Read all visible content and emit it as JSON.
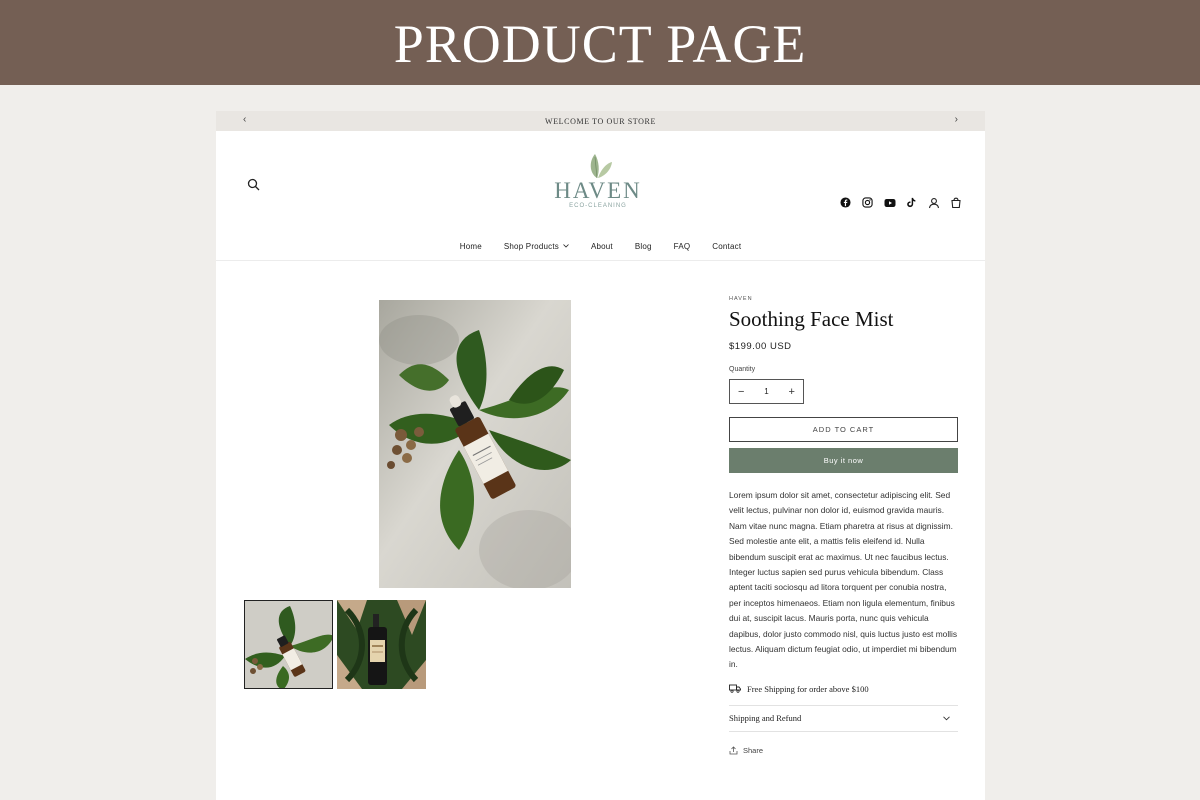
{
  "banner": {
    "title": "PRODUCT PAGE"
  },
  "announcement": {
    "text": "WELCOME TO OUR STORE",
    "prev_icon": "chevron-left-icon",
    "next_icon": "chevron-right-icon"
  },
  "logo": {
    "name": "HAVEN",
    "tagline": "ECO-CLEANING"
  },
  "header_icons": [
    "facebook-icon",
    "instagram-icon",
    "youtube-icon",
    "tiktok-icon",
    "account-icon",
    "cart-icon"
  ],
  "nav": {
    "items": [
      {
        "label": "Home"
      },
      {
        "label": "Shop Products"
      },
      {
        "label": "About"
      },
      {
        "label": "Blog"
      },
      {
        "label": "FAQ"
      },
      {
        "label": "Contact"
      }
    ]
  },
  "product": {
    "vendor": "HAVEN",
    "title": "Soothing Face Mist",
    "price": "$199.00 USD",
    "quantity_label": "Quantity",
    "quantity": "1",
    "add_to_cart": "ADD TO CART",
    "buy_now": "Buy it now",
    "description": "Lorem ipsum dolor sit amet, consectetur adipiscing elit. Sed velit lectus, pulvinar non dolor id, euismod gravida mauris. Nam vitae nunc magna. Etiam pharetra at risus at dignissim. Sed molestie ante elit, a mattis felis eleifend id. Nulla bibendum suscipit erat ac maximus. Ut nec faucibus lectus. Integer luctus sapien sed purus vehicula bibendum. Class aptent taciti sociosqu ad litora torquent per conubia nostra, per inceptos himenaeos. Etiam non ligula elementum, finibus dui at, suscipit lacus. Mauris porta, nunc quis vehicula dapibus, dolor justo commodo nisl, quis luctus justo est mollis lectus. Aliquam dictum feugiat odio, ut imperdiet mi bibendum in.",
    "shipping_note": "Free Shipping for order above $100",
    "accordion_label": "Shipping and Refund",
    "share": "Share"
  },
  "colors": {
    "banner_bg": "#745f54",
    "page_bg": "#f0eeeb",
    "buy_button": "#6b7e6d",
    "logo": "#6d8a86"
  }
}
